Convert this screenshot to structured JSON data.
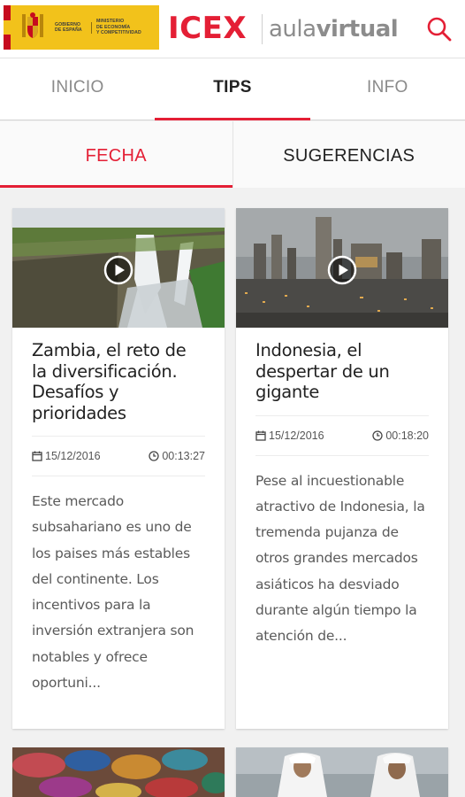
{
  "header": {
    "gov_logo": {
      "col1": [
        "GOBIERNO",
        "DE ESPAÑA"
      ],
      "col2": [
        "MINISTERIO",
        "DE ECONOMÍA",
        "Y COMPETITIVIDAD"
      ]
    },
    "icex_logo": "ICEX",
    "aula_light": "aula",
    "aula_bold": "virtual",
    "search_icon": "search-icon"
  },
  "main_tabs": [
    {
      "label": "INICIO",
      "active": false
    },
    {
      "label": "TIPS",
      "active": true
    },
    {
      "label": "INFO",
      "active": false
    }
  ],
  "sub_tabs": [
    {
      "label": "FECHA",
      "active": true
    },
    {
      "label": "SUGERENCIAS",
      "active": false
    }
  ],
  "colors": {
    "accent": "#e41f35",
    "gov_yellow": "#f2c21b"
  },
  "cards": [
    {
      "image": "waterfall-photo",
      "title": "Zambia, el reto de la diversificación. Desafíos y prioridades",
      "date": "15/12/2016",
      "duration": "00:13:27",
      "description": "Este mercado subsahariano es uno de los paises más estables del continente. Los incentivos para la inversión extranjera son notables y ofrece oportuni..."
    },
    {
      "image": "city-skyline-photo",
      "title": "Indonesia, el despertar de un gigante",
      "date": "15/12/2016",
      "duration": "00:18:20",
      "description": "Pese al incuestionable atractivo de Indonesia, la tremenda pujanza de otros grandes mercados asiáticos ha desviado durante algún tiempo la atención de..."
    },
    {
      "image": "pottery-market-photo"
    },
    {
      "image": "men-in-dishdasha-photo"
    }
  ]
}
